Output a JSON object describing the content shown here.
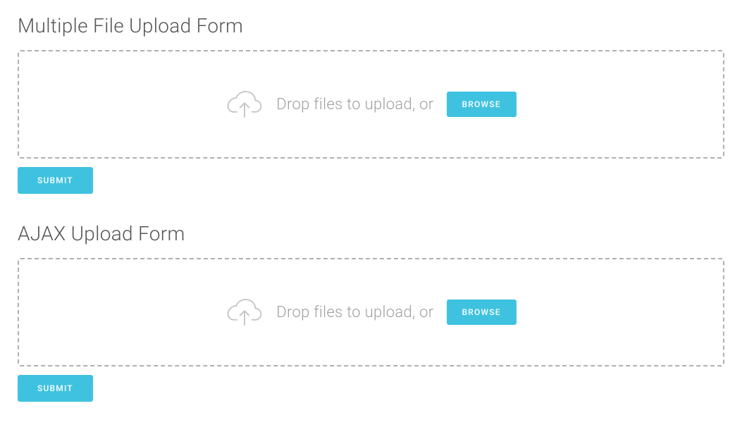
{
  "sections": [
    {
      "title": "Multiple File Upload Form",
      "drop_text": "Drop files to upload, or",
      "browse_label": "BROWSE",
      "submit_label": "SUBMIT"
    },
    {
      "title": "AJAX Upload Form",
      "drop_text": "Drop files to upload, or",
      "browse_label": "BROWSE",
      "submit_label": "SUBMIT"
    }
  ]
}
